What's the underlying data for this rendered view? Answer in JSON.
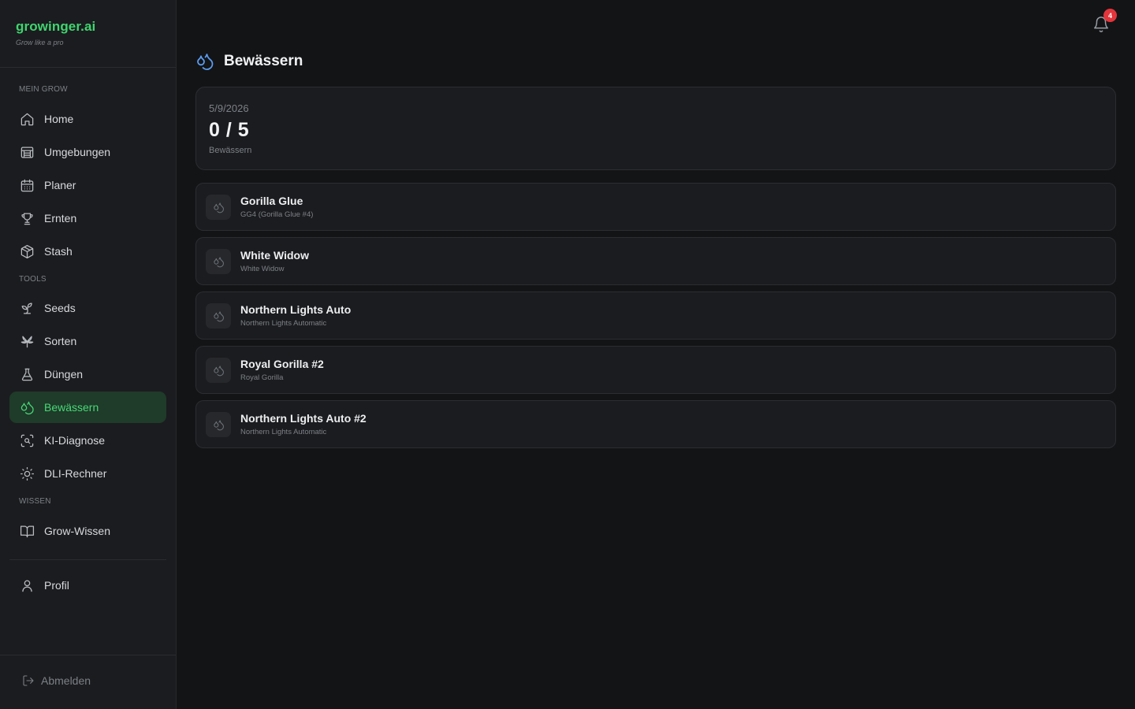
{
  "brand": {
    "name": "growinger.ai",
    "tagline": "Grow like a pro"
  },
  "sidebar": {
    "sections": {
      "mein_grow": "MEIN GROW",
      "tools": "TOOLS",
      "wissen": "WISSEN"
    },
    "items": [
      {
        "label": "Home",
        "icon": "home-icon"
      },
      {
        "label": "Umgebungen",
        "icon": "tent-icon"
      },
      {
        "label": "Planer",
        "icon": "calendar-icon"
      },
      {
        "label": "Ernten",
        "icon": "trophy-icon"
      },
      {
        "label": "Stash",
        "icon": "box-icon"
      },
      {
        "label": "Seeds",
        "icon": "sprout-icon"
      },
      {
        "label": "Sorten",
        "icon": "strain-icon"
      },
      {
        "label": "Düngen",
        "icon": "flask-icon"
      },
      {
        "label": "Bewässern",
        "icon": "droplets-icon",
        "active": true
      },
      {
        "label": "KI-Diagnose",
        "icon": "scan-icon"
      },
      {
        "label": "DLI-Rechner",
        "icon": "sun-icon"
      },
      {
        "label": "Grow-Wissen",
        "icon": "book-icon"
      },
      {
        "label": "Profil",
        "icon": "user-icon"
      }
    ],
    "logout": "Abmelden"
  },
  "header": {
    "notifications_count": "4"
  },
  "page": {
    "title": "Bewässern",
    "accent": "#5b9cf0",
    "summary": {
      "date": "5/9/2026",
      "count": "0 / 5",
      "label": "Bewässern"
    },
    "plants": [
      {
        "name": "Gorilla Glue",
        "strain": "GG4 (Gorilla Glue #4)"
      },
      {
        "name": "White Widow",
        "strain": "White Widow"
      },
      {
        "name": "Northern Lights Auto",
        "strain": "Northern Lights Automatic"
      },
      {
        "name": "Royal Gorilla #2",
        "strain": "Royal Gorilla"
      },
      {
        "name": "Northern Lights Auto #2",
        "strain": "Northern Lights Automatic"
      }
    ]
  },
  "colors": {
    "brand_green": "#3fd56f",
    "active_bg": "#1f3b29",
    "badge_red": "#e2353c"
  }
}
